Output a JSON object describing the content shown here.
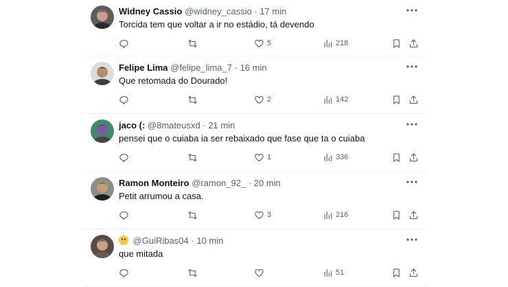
{
  "tweets": [
    {
      "name": "Widney Cassio",
      "handle": "@widney_cassio",
      "separator": "·",
      "time": "17 min",
      "text": "Torcida tem que voltar a ir no estádio, tá devendo",
      "replies": "",
      "retweets": "",
      "likes": "5",
      "views": "218",
      "avatar": {
        "bg": "#5c5c5c",
        "skin": "#c7a08a",
        "hair": "#222222",
        "shirt": "#2a2a2a"
      }
    },
    {
      "name": "Felipe Lima",
      "handle": "@felipe_lima_7",
      "separator": "·",
      "time": "16 min",
      "text": "Que retomada do Dourado!",
      "replies": "",
      "retweets": "",
      "likes": "2",
      "views": "142",
      "avatar": {
        "bg": "#d9dde0",
        "skin": "#b88a6e",
        "hair": "#2b1f18",
        "shirt": "#3a3f45"
      }
    },
    {
      "name": "jaco (:",
      "handle": "@8mateusxd",
      "separator": "·",
      "time": "21 min",
      "text": "pensei que o cuiaba ia ser rebaixado que fase que ta o cuiaba",
      "replies": "",
      "retweets": "",
      "likes": "1",
      "views": "336",
      "avatar": {
        "bg": "#3f8a6a",
        "skin": "#7a5aa8",
        "hair": "#2a2a2a",
        "shirt": "#444444"
      }
    },
    {
      "name": "Ramon Monteiro",
      "handle": "@ramon_92_",
      "separator": "·",
      "time": "20 min",
      "text": "Petit arrumou a casa.",
      "replies": "",
      "retweets": "",
      "likes": "3",
      "views": "216",
      "avatar": {
        "bg": "#8a8f86",
        "skin": "#c49a7a",
        "hair": "#3a2a1e",
        "shirt": "#1f1f1f"
      }
    },
    {
      "name": "",
      "name_icon": "slightly-smiling-emoji-icon",
      "handle": "@GuiRibas04",
      "separator": "·",
      "time": "10 min",
      "text": "que mitada",
      "replies": "",
      "retweets": "",
      "likes": "",
      "views": "51",
      "avatar": {
        "bg": "#5a4a45",
        "skin": "#c9a08c",
        "hair": "#2a1f1a",
        "shirt": "#6a5a55"
      }
    }
  ],
  "colors": {
    "text_primary": "#0f1419",
    "text_secondary": "#536471",
    "divider": "#eff3f4"
  },
  "icons": [
    "more-icon",
    "reply-icon",
    "retweet-icon",
    "like-icon",
    "views-icon",
    "bookmark-icon",
    "share-icon"
  ]
}
